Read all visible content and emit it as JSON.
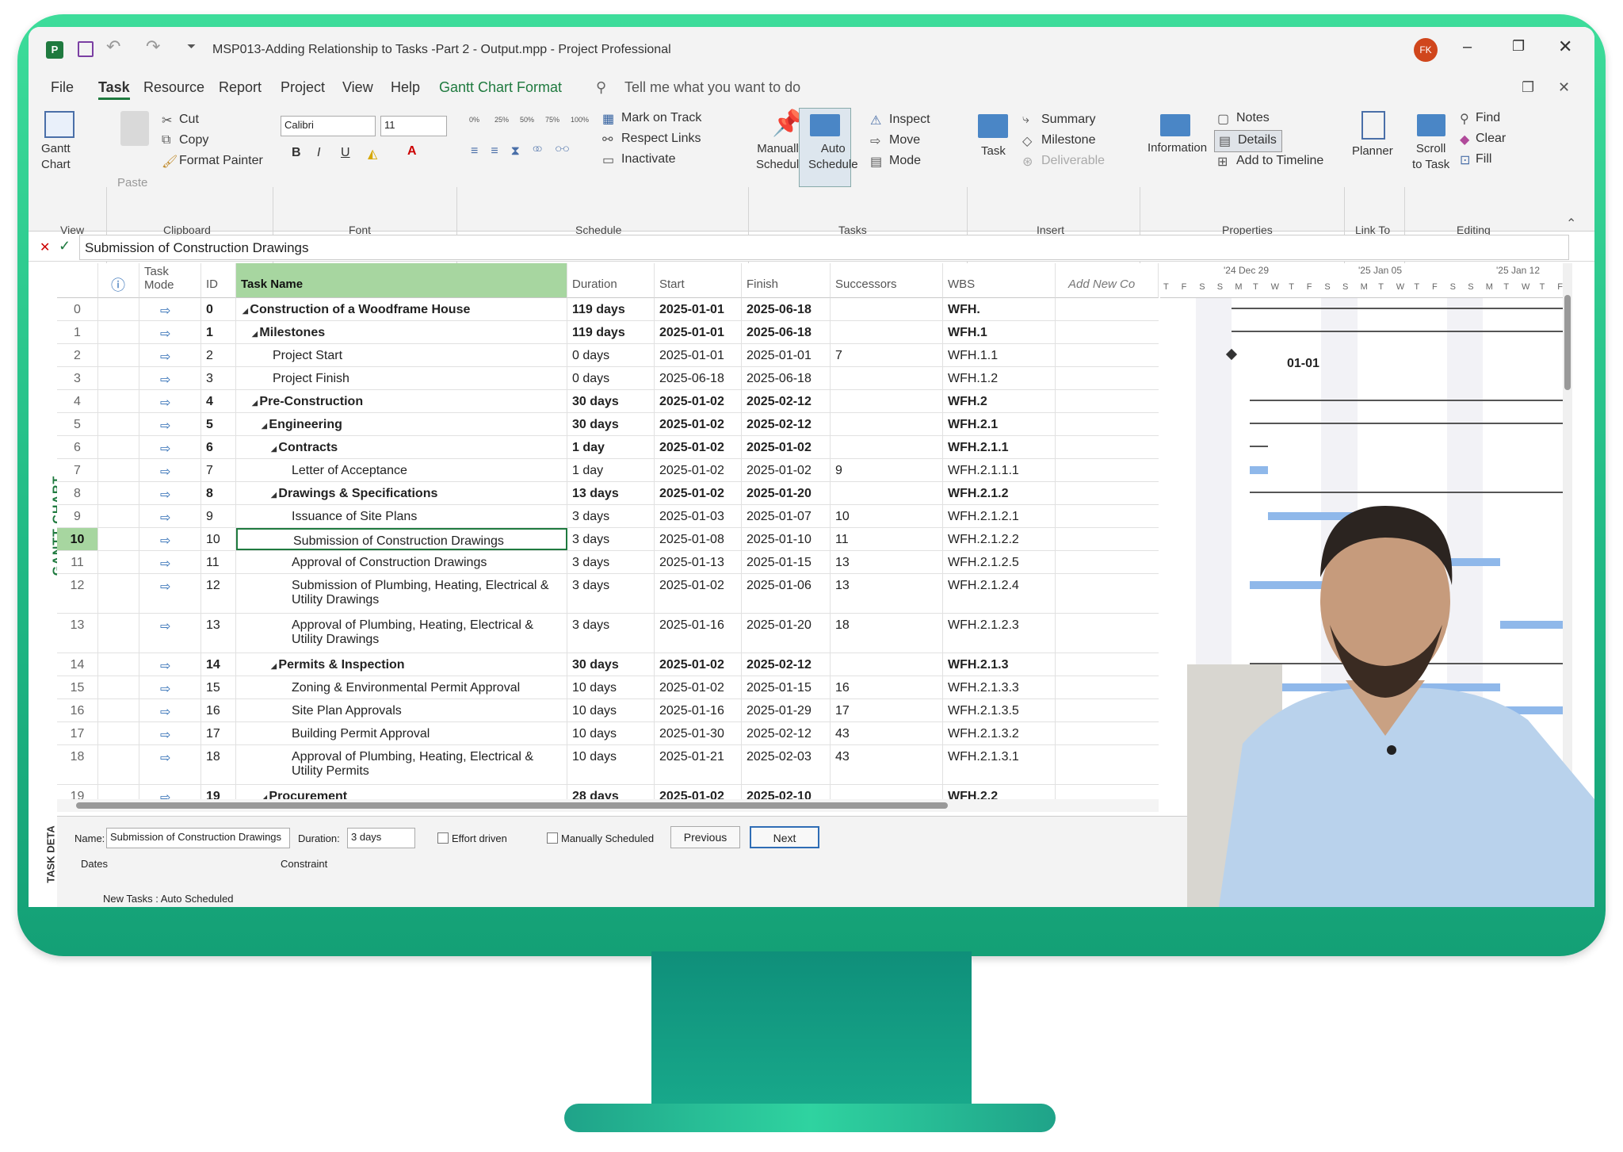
{
  "titlebar": {
    "title": "MSP013-Adding Relationship to Tasks -Part 2 - Output.mpp  -  Project Professional",
    "user_initials": "FK"
  },
  "ribbon_tabs": [
    "File",
    "Task",
    "Resource",
    "Report",
    "Project",
    "View",
    "Help",
    "Gantt Chart Format"
  ],
  "tell_me": "Tell me what you want to do",
  "ribbon": {
    "view_group": {
      "gantt_chart": "Gantt\nChart",
      "label": "View"
    },
    "clipboard": {
      "paste": "Paste",
      "cut": "Cut",
      "copy": "Copy",
      "format_painter": "Format Painter",
      "label": "Clipboard"
    },
    "font": {
      "family": "Calibri",
      "size": "11",
      "label": "Font"
    },
    "schedule": {
      "mark_on_track": "Mark on Track",
      "respect_links": "Respect Links",
      "inactivate": "Inactivate",
      "label": "Schedule",
      "pcts": [
        "0%",
        "25%",
        "50%",
        "75%",
        "100%"
      ]
    },
    "tasks": {
      "manually": "Manually\nSchedule",
      "auto": "Auto\nSchedule",
      "inspect": "Inspect",
      "move": "Move",
      "mode": "Mode",
      "label": "Tasks"
    },
    "insert": {
      "task": "Task",
      "summary": "Summary",
      "milestone": "Milestone",
      "deliverable": "Deliverable",
      "label": "Insert"
    },
    "properties": {
      "information": "Information",
      "notes": "Notes",
      "details": "Details",
      "add_timeline": "Add to Timeline",
      "label": "Properties"
    },
    "linkto": {
      "planner": "Planner",
      "label": "Link To"
    },
    "editing": {
      "scroll": "Scroll\nto Task",
      "find": "Find",
      "clear": "Clear",
      "fill": "Fill",
      "label": "Editing"
    }
  },
  "formula_bar": {
    "value": "Submission of Construction Drawings"
  },
  "side_label": "GANTT CHART",
  "columns": {
    "mode": "Task\nMode",
    "id": "ID",
    "name": "Task Name",
    "duration": "Duration",
    "start": "Start",
    "finish": "Finish",
    "successors": "Successors",
    "wbs": "WBS",
    "add": "Add New Co"
  },
  "timescale": {
    "weeks": [
      "'24 Dec 29",
      "'25 Jan 05",
      "'25 Jan 12"
    ],
    "days": [
      "T",
      "F",
      "S",
      "S",
      "M",
      "T",
      "W",
      "T",
      "F",
      "S",
      "S",
      "M",
      "T",
      "W",
      "T",
      "F",
      "S",
      "S",
      "M",
      "T",
      "W",
      "T",
      "F"
    ]
  },
  "milestone_label": "01-01",
  "tasks": [
    {
      "row": "0",
      "id": "0",
      "name": "Construction of a Woodframe House",
      "indent": 0,
      "summary": true,
      "duration": "119 days",
      "start": "2025-01-01",
      "finish": "2025-06-18",
      "succ": "",
      "wbs": "WFH."
    },
    {
      "row": "1",
      "id": "1",
      "name": "Milestones",
      "indent": 1,
      "summary": true,
      "duration": "119 days",
      "start": "2025-01-01",
      "finish": "2025-06-18",
      "succ": "",
      "wbs": "WFH.1"
    },
    {
      "row": "2",
      "id": "2",
      "name": "Project Start",
      "indent": 2,
      "summary": false,
      "duration": "0 days",
      "start": "2025-01-01",
      "finish": "2025-01-01",
      "succ": "7",
      "wbs": "WFH.1.1"
    },
    {
      "row": "3",
      "id": "3",
      "name": "Project Finish",
      "indent": 2,
      "summary": false,
      "duration": "0 days",
      "start": "2025-06-18",
      "finish": "2025-06-18",
      "succ": "",
      "wbs": "WFH.1.2"
    },
    {
      "row": "4",
      "id": "4",
      "name": "Pre-Construction",
      "indent": 1,
      "summary": true,
      "duration": "30 days",
      "start": "2025-01-02",
      "finish": "2025-02-12",
      "succ": "",
      "wbs": "WFH.2"
    },
    {
      "row": "5",
      "id": "5",
      "name": "Engineering",
      "indent": 2,
      "summary": true,
      "duration": "30 days",
      "start": "2025-01-02",
      "finish": "2025-02-12",
      "succ": "",
      "wbs": "WFH.2.1"
    },
    {
      "row": "6",
      "id": "6",
      "name": "Contracts",
      "indent": 3,
      "summary": true,
      "duration": "1 day",
      "start": "2025-01-02",
      "finish": "2025-01-02",
      "succ": "",
      "wbs": "WFH.2.1.1"
    },
    {
      "row": "7",
      "id": "7",
      "name": "Letter of Acceptance",
      "indent": 4,
      "summary": false,
      "duration": "1 day",
      "start": "2025-01-02",
      "finish": "2025-01-02",
      "succ": "9",
      "wbs": "WFH.2.1.1.1"
    },
    {
      "row": "8",
      "id": "8",
      "name": "Drawings & Specifications",
      "indent": 3,
      "summary": true,
      "duration": "13 days",
      "start": "2025-01-02",
      "finish": "2025-01-20",
      "succ": "",
      "wbs": "WFH.2.1.2"
    },
    {
      "row": "9",
      "id": "9",
      "name": "Issuance of Site Plans",
      "indent": 4,
      "summary": false,
      "duration": "3 days",
      "start": "2025-01-03",
      "finish": "2025-01-07",
      "succ": "10",
      "wbs": "WFH.2.1.2.1"
    },
    {
      "row": "10",
      "id": "10",
      "name": "Submission of Construction Drawings",
      "indent": 4,
      "summary": false,
      "duration": "3 days",
      "start": "2025-01-08",
      "finish": "2025-01-10",
      "succ": "11",
      "wbs": "WFH.2.1.2.2",
      "selected": true
    },
    {
      "row": "11",
      "id": "11",
      "name": "Approval of Construction Drawings",
      "indent": 4,
      "summary": false,
      "duration": "3 days",
      "start": "2025-01-13",
      "finish": "2025-01-15",
      "succ": "13",
      "wbs": "WFH.2.1.2.5"
    },
    {
      "row": "12",
      "id": "12",
      "name": "Submission of Plumbing, Heating, Electrical &",
      "name2": "Utility Drawings",
      "indent": 4,
      "summary": false,
      "duration": "3 days",
      "start": "2025-01-02",
      "finish": "2025-01-06",
      "succ": "13",
      "wbs": "WFH.2.1.2.4"
    },
    {
      "row": "13",
      "id": "13",
      "name": "Approval of Plumbing, Heating, Electrical &",
      "name2": "Utility Drawings",
      "indent": 4,
      "summary": false,
      "duration": "3 days",
      "start": "2025-01-16",
      "finish": "2025-01-20",
      "succ": "18",
      "wbs": "WFH.2.1.2.3"
    },
    {
      "row": "14",
      "id": "14",
      "name": "Permits & Inspection",
      "indent": 3,
      "summary": true,
      "duration": "30 days",
      "start": "2025-01-02",
      "finish": "2025-02-12",
      "succ": "",
      "wbs": "WFH.2.1.3"
    },
    {
      "row": "15",
      "id": "15",
      "name": "Zoning & Environmental Permit Approval",
      "indent": 4,
      "summary": false,
      "duration": "10 days",
      "start": "2025-01-02",
      "finish": "2025-01-15",
      "succ": "16",
      "wbs": "WFH.2.1.3.3"
    },
    {
      "row": "16",
      "id": "16",
      "name": "Site Plan Approvals",
      "indent": 4,
      "summary": false,
      "duration": "10 days",
      "start": "2025-01-16",
      "finish": "2025-01-29",
      "succ": "17",
      "wbs": "WFH.2.1.3.5"
    },
    {
      "row": "17",
      "id": "17",
      "name": "Building Permit Approval",
      "indent": 4,
      "summary": false,
      "duration": "10 days",
      "start": "2025-01-30",
      "finish": "2025-02-12",
      "succ": "43",
      "wbs": "WFH.2.1.3.2"
    },
    {
      "row": "18",
      "id": "18",
      "name": "Approval of Plumbing, Heating, Electrical &",
      "name2": "Utility Permits",
      "indent": 4,
      "summary": false,
      "duration": "10 days",
      "start": "2025-01-21",
      "finish": "2025-02-03",
      "succ": "43",
      "wbs": "WFH.2.1.3.1"
    },
    {
      "row": "19",
      "id": "19",
      "name": "Procurement",
      "indent": 2,
      "summary": true,
      "duration": "28 days",
      "start": "2025-01-02",
      "finish": "2025-02-10",
      "succ": "",
      "wbs": "WFH.2.2"
    }
  ],
  "details_pane": {
    "side_label": "TASK DETA",
    "name_label": "Name:",
    "name_value": "Submission of Construction Drawings",
    "duration_label": "Duration:",
    "duration_value": "3 days",
    "effort_driven": "Effort driven",
    "manually_scheduled": "Manually Scheduled",
    "previous": "Previous",
    "next": "Next",
    "dates": "Dates",
    "constraint": "Constraint"
  },
  "status_bar": "New Tasks : Auto Scheduled",
  "colors": {
    "accent_green": "#a7d6a0",
    "monitor": "#22c28a",
    "bar": "#8fb8ea"
  }
}
